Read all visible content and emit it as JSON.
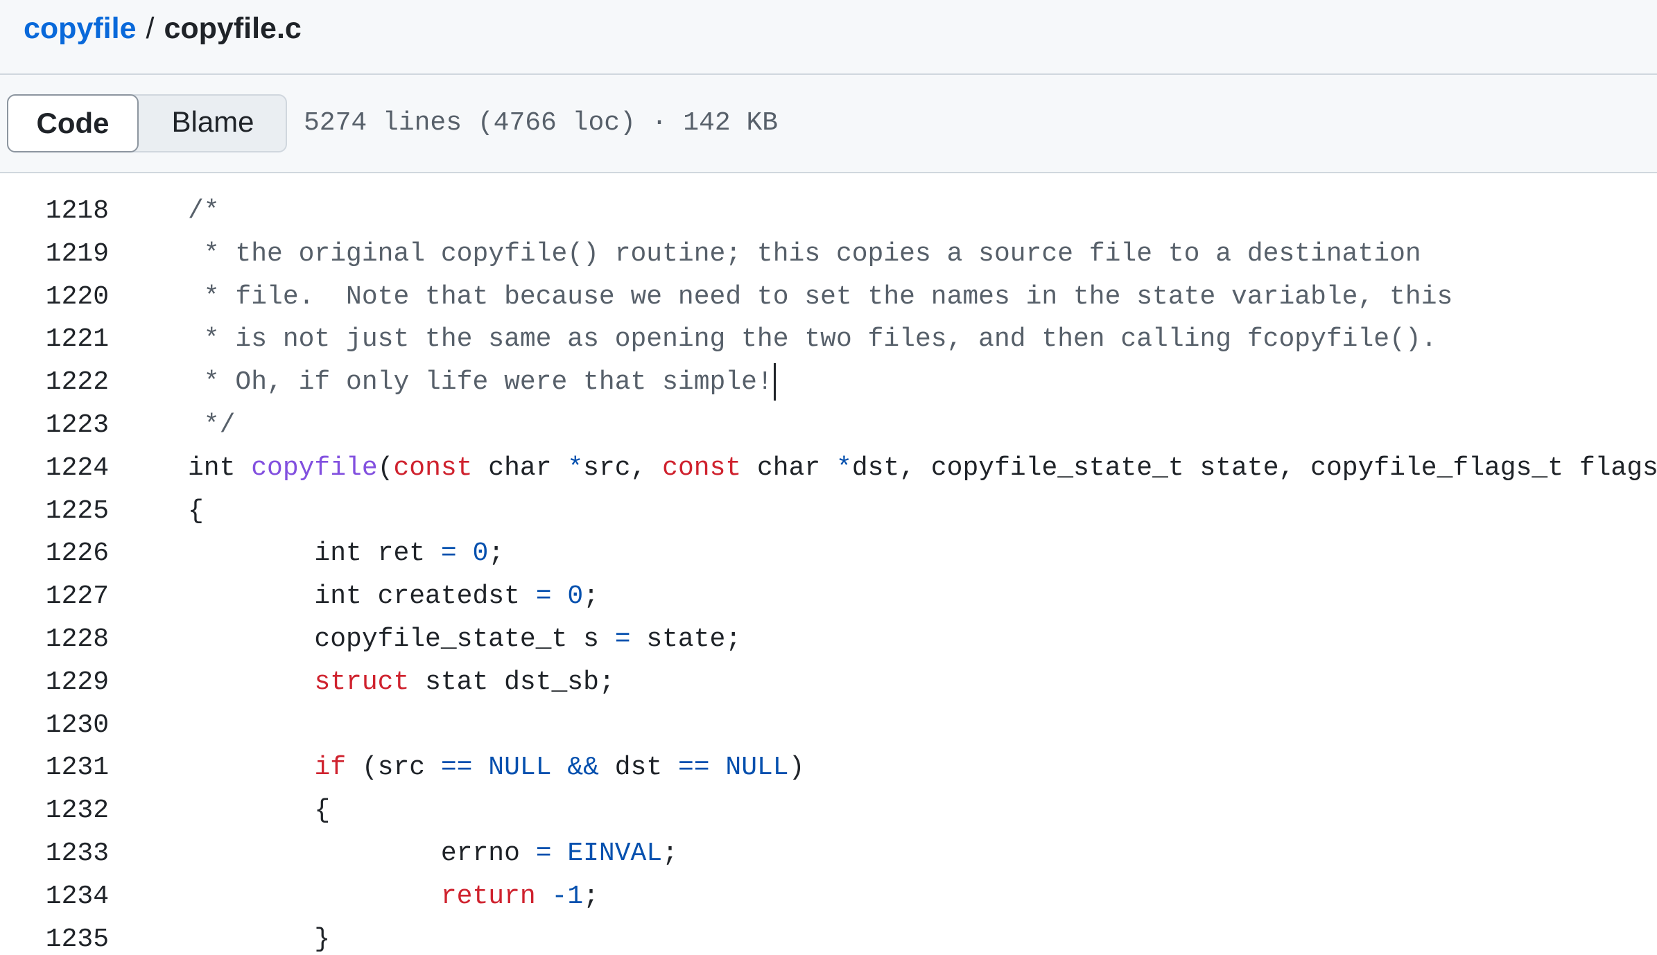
{
  "breadcrumb": {
    "repo": "copyfile",
    "separator": "/",
    "file": "copyfile.c"
  },
  "toolbar": {
    "code_label": "Code",
    "blame_label": "Blame",
    "file_info": "5274 lines (4766 loc) · 142 KB"
  },
  "colors": {
    "link": "#0969da",
    "comment": "#57606a",
    "keyword": "#cf222e",
    "function": "#8250df",
    "constant": "#0550ae"
  },
  "code": {
    "lines": [
      {
        "num": "1218",
        "tokens": [
          {
            "t": "/*",
            "c": "comment"
          }
        ]
      },
      {
        "num": "1219",
        "tokens": [
          {
            "t": " * the original copyfile() routine; this copies a source file to a destination",
            "c": "comment"
          }
        ]
      },
      {
        "num": "1220",
        "tokens": [
          {
            "t": " * file.  Note that because we need to set the names in the state variable, this",
            "c": "comment"
          }
        ]
      },
      {
        "num": "1221",
        "tokens": [
          {
            "t": " * is not just the same as opening the two files, and then calling fcopyfile().",
            "c": "comment"
          }
        ]
      },
      {
        "num": "1222",
        "tokens": [
          {
            "t": " * Oh, if only life were that simple!",
            "c": "comment"
          }
        ],
        "caret": true
      },
      {
        "num": "1223",
        "tokens": [
          {
            "t": " */",
            "c": "comment"
          }
        ]
      },
      {
        "num": "1224",
        "tokens": [
          {
            "t": "int ",
            "c": "plain"
          },
          {
            "t": "copyfile",
            "c": "func"
          },
          {
            "t": "(",
            "c": "plain"
          },
          {
            "t": "const",
            "c": "keyword"
          },
          {
            "t": " char ",
            "c": "plain"
          },
          {
            "t": "*",
            "c": "op"
          },
          {
            "t": "src, ",
            "c": "plain"
          },
          {
            "t": "const",
            "c": "keyword"
          },
          {
            "t": " char ",
            "c": "plain"
          },
          {
            "t": "*",
            "c": "op"
          },
          {
            "t": "dst, copyfile_state_t state, copyfile_flags_t flags)",
            "c": "plain"
          }
        ]
      },
      {
        "num": "1225",
        "tokens": [
          {
            "t": "{",
            "c": "plain"
          }
        ]
      },
      {
        "num": "1226",
        "tokens": [
          {
            "t": "        int ret ",
            "c": "plain"
          },
          {
            "t": "=",
            "c": "op"
          },
          {
            "t": " ",
            "c": "plain"
          },
          {
            "t": "0",
            "c": "const"
          },
          {
            "t": ";",
            "c": "plain"
          }
        ]
      },
      {
        "num": "1227",
        "tokens": [
          {
            "t": "        int createdst ",
            "c": "plain"
          },
          {
            "t": "=",
            "c": "op"
          },
          {
            "t": " ",
            "c": "plain"
          },
          {
            "t": "0",
            "c": "const"
          },
          {
            "t": ";",
            "c": "plain"
          }
        ]
      },
      {
        "num": "1228",
        "tokens": [
          {
            "t": "        copyfile_state_t s ",
            "c": "plain"
          },
          {
            "t": "=",
            "c": "op"
          },
          {
            "t": " state;",
            "c": "plain"
          }
        ]
      },
      {
        "num": "1229",
        "tokens": [
          {
            "t": "        ",
            "c": "plain"
          },
          {
            "t": "struct",
            "c": "keyword"
          },
          {
            "t": " stat dst_sb;",
            "c": "plain"
          }
        ]
      },
      {
        "num": "1230",
        "tokens": [
          {
            "t": "",
            "c": "plain"
          }
        ]
      },
      {
        "num": "1231",
        "tokens": [
          {
            "t": "        ",
            "c": "plain"
          },
          {
            "t": "if",
            "c": "keyword"
          },
          {
            "t": " (src ",
            "c": "plain"
          },
          {
            "t": "==",
            "c": "op"
          },
          {
            "t": " ",
            "c": "plain"
          },
          {
            "t": "NULL",
            "c": "const"
          },
          {
            "t": " ",
            "c": "plain"
          },
          {
            "t": "&&",
            "c": "op"
          },
          {
            "t": " dst ",
            "c": "plain"
          },
          {
            "t": "==",
            "c": "op"
          },
          {
            "t": " ",
            "c": "plain"
          },
          {
            "t": "NULL",
            "c": "const"
          },
          {
            "t": ")",
            "c": "plain"
          }
        ]
      },
      {
        "num": "1232",
        "tokens": [
          {
            "t": "        {",
            "c": "plain"
          }
        ]
      },
      {
        "num": "1233",
        "tokens": [
          {
            "t": "                errno ",
            "c": "plain"
          },
          {
            "t": "=",
            "c": "op"
          },
          {
            "t": " ",
            "c": "plain"
          },
          {
            "t": "EINVAL",
            "c": "const"
          },
          {
            "t": ";",
            "c": "plain"
          }
        ]
      },
      {
        "num": "1234",
        "tokens": [
          {
            "t": "                ",
            "c": "plain"
          },
          {
            "t": "return",
            "c": "keyword"
          },
          {
            "t": " ",
            "c": "plain"
          },
          {
            "t": "-",
            "c": "op"
          },
          {
            "t": "1",
            "c": "const"
          },
          {
            "t": ";",
            "c": "plain"
          }
        ]
      },
      {
        "num": "1235",
        "tokens": [
          {
            "t": "        }",
            "c": "plain"
          }
        ]
      }
    ]
  }
}
